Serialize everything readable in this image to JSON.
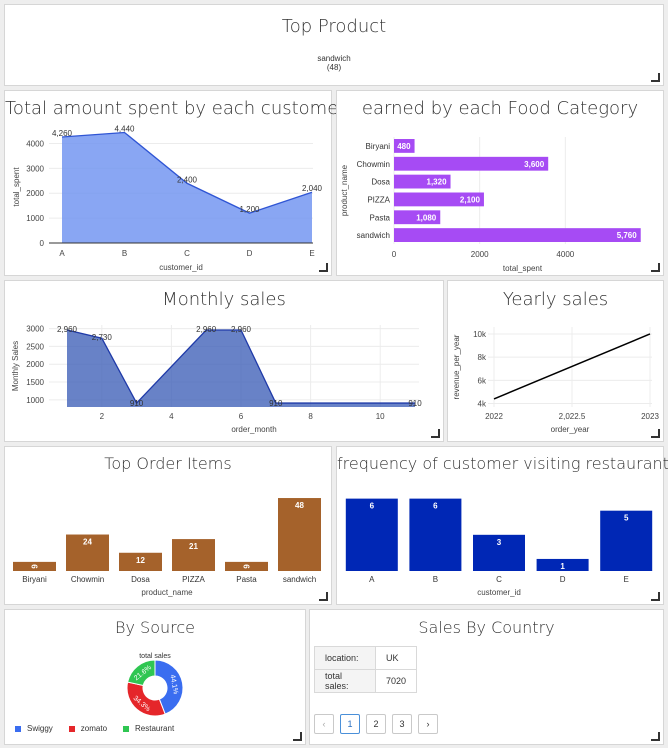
{
  "top_product": {
    "title": "Top Product",
    "name": "sandwich",
    "count": "(48)"
  },
  "charts": {
    "spent": {
      "title": "Total amount spent by each customer",
      "chart_data": {
        "type": "area",
        "categories": [
          "A",
          "B",
          "C",
          "D",
          "E"
        ],
        "values": [
          4260,
          4440,
          2400,
          1200,
          2040
        ],
        "value_labels": [
          "4,260",
          "4,440",
          "2,400",
          "1,200",
          "2,040"
        ],
        "xlabel": "customer_id",
        "ylabel": "total_spent",
        "ylim": [
          0,
          4500
        ],
        "yticks": [
          "0",
          "1000",
          "2000",
          "3000",
          "4000"
        ],
        "color": "#6f93f0"
      }
    },
    "earned": {
      "title": "earned by each Food Category",
      "chart_data": {
        "type": "bar",
        "orientation": "horizontal",
        "categories": [
          "Biryani",
          "Chowmin",
          "Dosa",
          "PIZZA",
          "Pasta",
          "sandwich"
        ],
        "values": [
          480,
          3600,
          1320,
          2100,
          1080,
          5760
        ],
        "value_labels": [
          "480",
          "3,600",
          "1,320",
          "2,100",
          "1,080",
          "5,760"
        ],
        "xlabel": "total_spent",
        "ylabel": "product_name",
        "xlim": [
          0,
          6000
        ],
        "xticks": [
          "0",
          "2000",
          "4000"
        ],
        "color": "#a64bf4"
      }
    },
    "monthly": {
      "title": "Monthly sales",
      "chart_data": {
        "type": "area",
        "x": [
          1,
          2,
          3,
          5,
          6,
          7,
          11
        ],
        "values": [
          2960,
          2730,
          910,
          2960,
          2960,
          910,
          910
        ],
        "value_labels": [
          "2,960",
          "2,730",
          "910",
          "2,960",
          "2,960",
          "910",
          "910"
        ],
        "xlabel": "order_month",
        "ylabel": "Monthly Sales",
        "xticks": [
          "2",
          "4",
          "6",
          "8",
          "10"
        ],
        "yticks": [
          "1000",
          "1500",
          "2000",
          "2500",
          "3000"
        ],
        "color": "#3d5fb7"
      }
    },
    "yearly": {
      "title": "Yearly sales",
      "chart_data": {
        "type": "line",
        "x": [
          2022,
          2023
        ],
        "values": [
          4400,
          10000
        ],
        "xlabel": "order_year",
        "ylabel": "revenue_per_year",
        "xticks": [
          "2022",
          "2,022.5",
          "2023"
        ],
        "yticks": [
          "4k",
          "6k",
          "8k",
          "10k"
        ],
        "color": "#000000"
      }
    },
    "top_items": {
      "title": "Top Order Items",
      "chart_data": {
        "type": "bar",
        "categories": [
          "Biryani",
          "Chowmin",
          "Dosa",
          "PIZZA",
          "Pasta",
          "sandwich"
        ],
        "values": [
          6,
          24,
          12,
          21,
          6,
          48
        ],
        "xlabel": "product_name",
        "ylabel": "",
        "ylim": [
          0,
          50
        ],
        "color": "#a5622b"
      }
    },
    "frequency": {
      "title": "frequency of customer visiting restaurant",
      "chart_data": {
        "type": "bar",
        "categories": [
          "A",
          "B",
          "C",
          "D",
          "E"
        ],
        "values": [
          6,
          6,
          3,
          1,
          5
        ],
        "xlabel": "customer_id",
        "ylabel": "",
        "ylim": [
          0,
          6.3
        ],
        "color": "#0027b5"
      }
    },
    "source": {
      "title": "By Source",
      "chart_data": {
        "type": "pie",
        "subtitle": "total sales",
        "categories": [
          "Swiggy",
          "zomato",
          "Restaurant"
        ],
        "values": [
          44.1,
          34.3,
          21.6
        ],
        "value_labels": [
          "44.1%",
          "34.3%",
          "21.6%"
        ],
        "colors": [
          "#3a6df0",
          "#e5262a",
          "#2fc652"
        ]
      }
    }
  },
  "country": {
    "title": "Sales By Country",
    "location_label": "location:",
    "location_value": "UK",
    "sales_label": "total sales:",
    "sales_value": "7020",
    "pages": [
      "1",
      "2",
      "3"
    ],
    "prev": "‹",
    "next": "›"
  }
}
